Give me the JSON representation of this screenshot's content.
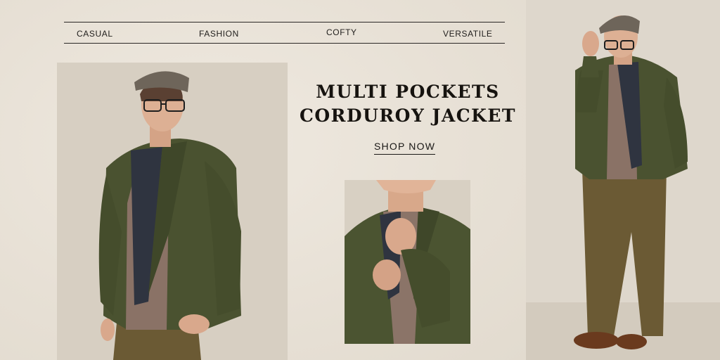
{
  "tags": [
    "CASUAL",
    "FASHION",
    "COFTY",
    "VERSATILE"
  ],
  "headline": {
    "line1": "MULTI POCKETS",
    "line2": "CORDUROY JACKET"
  },
  "cta": {
    "label": "SHOP NOW"
  },
  "colors": {
    "background": "#ece6dd",
    "jacket": "#4a5230",
    "cap": "#6e655a",
    "pants": "#6b5a34",
    "text": "#16130f"
  }
}
